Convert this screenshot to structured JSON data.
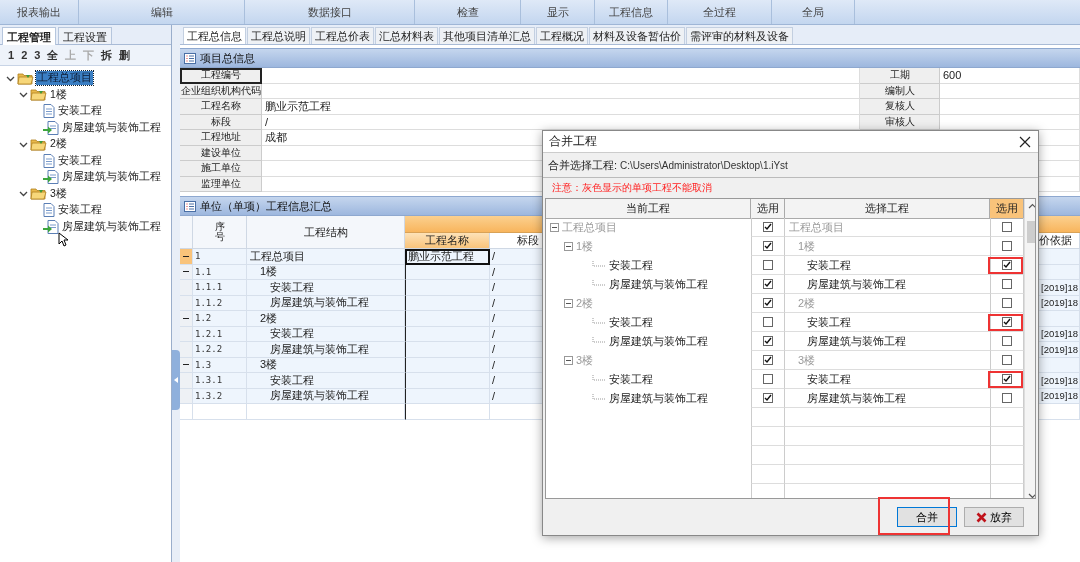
{
  "toolbar_groups": [
    "报表输出",
    "编辑",
    "数据接口",
    "检查",
    "显示",
    "工程信息",
    "全过程",
    "全局"
  ],
  "left_panel": {
    "tabs": [
      {
        "label": "工程管理",
        "selected": true
      },
      {
        "label": "工程设置",
        "selected": false
      }
    ],
    "tools": [
      {
        "label": "1",
        "disabled": false
      },
      {
        "label": "2",
        "disabled": false
      },
      {
        "label": "3",
        "disabled": false
      },
      {
        "label": "全",
        "disabled": false
      },
      {
        "label": "上",
        "disabled": true
      },
      {
        "label": "下",
        "disabled": true
      },
      {
        "label": "拆",
        "disabled": false
      },
      {
        "label": "删",
        "disabled": false
      }
    ],
    "tree": [
      {
        "label": "工程总项目",
        "kind": "folder",
        "selected": true,
        "expanded": true,
        "children": [
          {
            "label": "1楼",
            "kind": "folder",
            "selected": false,
            "expanded": true,
            "children": [
              {
                "label": "安装工程",
                "kind": "document",
                "selected": false
              },
              {
                "label": "房屋建筑与装饰工程",
                "kind": "import",
                "selected": false
              }
            ]
          },
          {
            "label": "2楼",
            "kind": "folder",
            "selected": false,
            "expanded": true,
            "children": [
              {
                "label": "安装工程",
                "kind": "document",
                "selected": false
              },
              {
                "label": "房屋建筑与装饰工程",
                "kind": "import",
                "selected": false
              }
            ]
          },
          {
            "label": "3楼",
            "kind": "folder",
            "selected": false,
            "expanded": true,
            "children": [
              {
                "label": "安装工程",
                "kind": "document",
                "selected": false
              },
              {
                "label": "房屋建筑与装饰工程",
                "kind": "import",
                "selected": false
              }
            ]
          }
        ]
      }
    ]
  },
  "content_tabs": [
    {
      "label": "工程总信息",
      "selected": true
    },
    {
      "label": "工程总说明",
      "selected": false
    },
    {
      "label": "工程总价表",
      "selected": false
    },
    {
      "label": "汇总材料表",
      "selected": false
    },
    {
      "label": "其他项目清单汇总",
      "selected": false
    },
    {
      "label": "工程概况",
      "selected": false
    },
    {
      "label": "材料及设备暂估价",
      "selected": false
    },
    {
      "label": "需评审的材料及设备",
      "selected": false
    }
  ],
  "project_info": {
    "title": "项目总信息",
    "rows": [
      {
        "label": "工程编号",
        "label2": "工期",
        "value2": "600"
      },
      {
        "label": "企业组织机构代码",
        "label2": "编制人"
      },
      {
        "label": "工程名称",
        "value": "鹏业示范工程",
        "label2": "复核人"
      },
      {
        "label": "标段",
        "value": "/",
        "label2": "审核人"
      },
      {
        "label": "工程地址",
        "value": "成都"
      },
      {
        "label": "建设单位"
      },
      {
        "label": "施工单位"
      },
      {
        "label": "监理单位"
      }
    ]
  },
  "unit_summary": {
    "title": "单位（单项）工程信息汇总",
    "columns": [
      "序号",
      "工程结构",
      "工程名称",
      "标段",
      "价依据"
    ],
    "rows": [
      {
        "seq": "1",
        "structure": "工程总项目",
        "name": "鹏业示范工程",
        "section": "/",
        "selected": true,
        "expanded": true,
        "children": [
          {
            "seq": "1.1",
            "structure": "1楼",
            "section": "/",
            "selected": false,
            "expanded": true,
            "children": [
              {
                "seq": "1.1.1",
                "structure": "安装工程",
                "section": "/",
                "basis": "[2019]18",
                "selected": false
              },
              {
                "seq": "1.1.2",
                "structure": "房屋建筑与装饰工程",
                "section": "/",
                "basis": "[2019]18",
                "selected": false
              }
            ]
          },
          {
            "seq": "1.2",
            "structure": "2楼",
            "section": "/",
            "selected": false,
            "expanded": true,
            "children": [
              {
                "seq": "1.2.1",
                "structure": "安装工程",
                "section": "/",
                "basis": "[2019]18",
                "selected": false
              },
              {
                "seq": "1.2.2",
                "structure": "房屋建筑与装饰工程",
                "section": "/",
                "basis": "[2019]18",
                "selected": false
              }
            ]
          },
          {
            "seq": "1.3",
            "structure": "3楼",
            "section": "/",
            "selected": false,
            "expanded": true,
            "children": [
              {
                "seq": "1.3.1",
                "structure": "安装工程",
                "section": "/",
                "basis": "[2019]18",
                "selected": false
              },
              {
                "seq": "1.3.2",
                "structure": "房屋建筑与装饰工程",
                "section": "/",
                "basis": "[2019]18",
                "selected": false
              }
            ]
          }
        ]
      }
    ]
  },
  "dialog": {
    "title": "合并工程",
    "path_label": "合并选择工程:",
    "path": "C:\\Users\\Administrator\\Desktop\\1.iYst",
    "notice": "注意：灰色显示的单项工程不能取消",
    "columns": [
      "当前工程",
      "选用",
      "选择工程",
      "选用"
    ],
    "rows": [
      {
        "current": "工程总项目",
        "current_checked": true,
        "select": "工程总项目",
        "select_checked": false,
        "disabled": true,
        "highlighted": false,
        "expanded": true,
        "children": [
          {
            "current": "1楼",
            "current_checked": true,
            "select": "1楼",
            "select_checked": false,
            "disabled": true,
            "highlighted": false,
            "expanded": true,
            "children": [
              {
                "current": "安装工程",
                "current_checked": false,
                "select": "安装工程",
                "select_checked": true,
                "disabled": false,
                "highlighted": true
              },
              {
                "current": "房屋建筑与装饰工程",
                "current_checked": true,
                "select": "房屋建筑与装饰工程",
                "select_checked": false,
                "disabled": false,
                "highlighted": false
              }
            ]
          },
          {
            "current": "2楼",
            "current_checked": true,
            "select": "2楼",
            "select_checked": false,
            "disabled": true,
            "highlighted": false,
            "expanded": true,
            "children": [
              {
                "current": "安装工程",
                "current_checked": false,
                "select": "安装工程",
                "select_checked": true,
                "disabled": false,
                "highlighted": true
              },
              {
                "current": "房屋建筑与装饰工程",
                "current_checked": true,
                "select": "房屋建筑与装饰工程",
                "select_checked": false,
                "disabled": false,
                "highlighted": false
              }
            ]
          },
          {
            "current": "3楼",
            "current_checked": true,
            "select": "3楼",
            "select_checked": false,
            "disabled": true,
            "highlighted": false,
            "expanded": true,
            "children": [
              {
                "current": "安装工程",
                "current_checked": false,
                "select": "安装工程",
                "select_checked": true,
                "disabled": false,
                "highlighted": true
              },
              {
                "current": "房屋建筑与装饰工程",
                "current_checked": true,
                "select": "房屋建筑与装饰工程",
                "select_checked": false,
                "disabled": false,
                "highlighted": false
              }
            ]
          }
        ]
      }
    ],
    "buttons": [
      {
        "label": "合并",
        "kind": "confirm",
        "focused": true,
        "highlighted": true
      },
      {
        "label": "放弃",
        "kind": "cancel",
        "focused": false,
        "highlighted": false
      }
    ]
  }
}
